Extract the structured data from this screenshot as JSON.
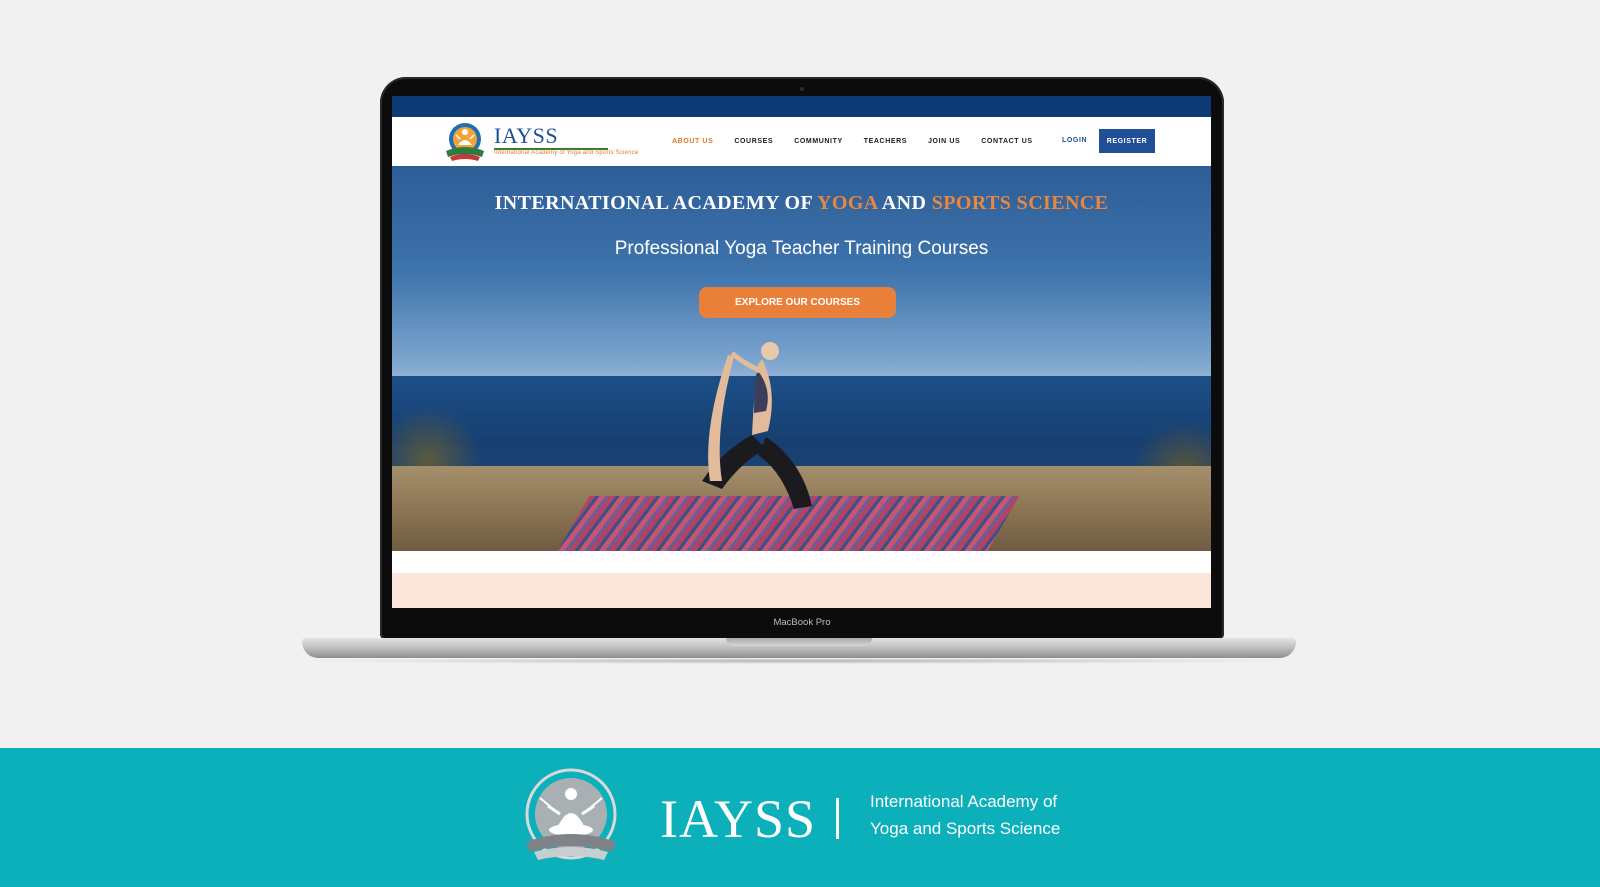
{
  "screen": {
    "header": {
      "logo_text": "IAYSS",
      "logo_tagline": "International Academy of Yoga and Sports Science",
      "nav": [
        {
          "label": "ABOUT US",
          "active": true
        },
        {
          "label": "COURSES",
          "active": false
        },
        {
          "label": "COMMUNITY",
          "active": false
        },
        {
          "label": "TEACHERS",
          "active": false
        },
        {
          "label": "JOIN US",
          "active": false
        },
        {
          "label": "CONTACT US",
          "active": false
        }
      ],
      "login_label": "LOGIN",
      "register_label": "REGISTER"
    },
    "hero": {
      "title_part1": "INTERNATIONAL ACADEMY OF ",
      "title_accent1": "YOGA",
      "title_part2": " AND ",
      "title_accent2": "SPORTS SCIENCE",
      "subtitle": "Professional Yoga Teacher Training Courses",
      "cta_label": "EXPLORE OUR COURSES"
    }
  },
  "device_label": "MacBook Pro",
  "footer": {
    "brand": "IAYSS",
    "description_line1": "International Academy of",
    "description_line2": "Yoga and Sports Science"
  },
  "colors": {
    "accent_orange": "#e8803a",
    "brand_blue": "#1f4f96",
    "footer_teal": "#0cb0ba",
    "peach_band": "#fbe5da"
  },
  "icons": [
    "iayss-logo-emblem",
    "meditating-figure-icon"
  ]
}
